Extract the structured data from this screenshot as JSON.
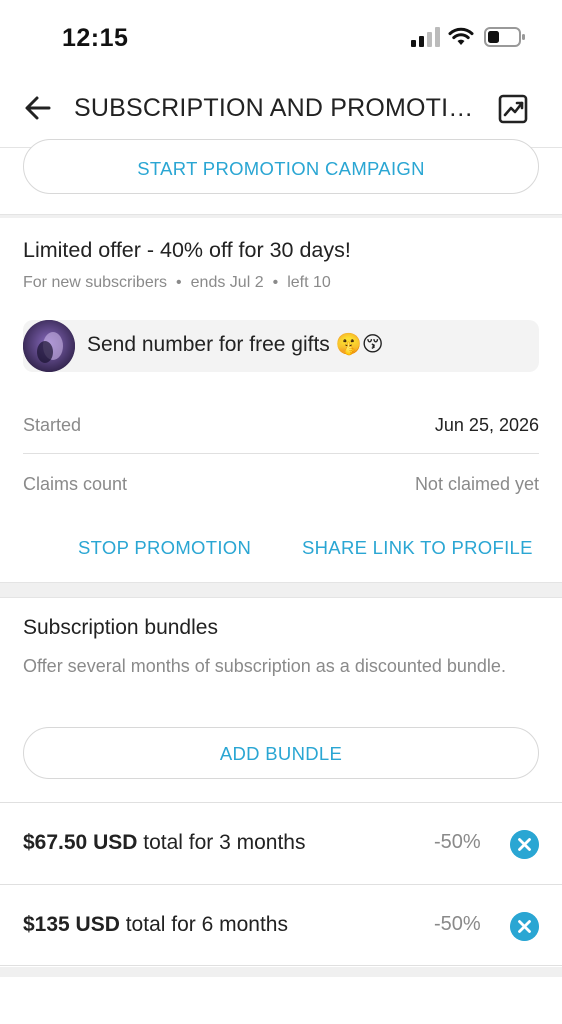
{
  "status_bar": {
    "time": "12:15"
  },
  "header": {
    "title": "SUBSCRIPTION AND PROMOTIONS"
  },
  "promotion": {
    "start_campaign_label": "START PROMOTION CAMPAIGN",
    "offer_title": "Limited offer - 40% off for 30 days!",
    "meta": {
      "audience": "For new subscribers",
      "ends": "ends Jul 2",
      "left": "left 10"
    },
    "message": "Send number for free gifts 🤫😚",
    "started_label": "Started",
    "started_value": "Jun 25, 2026",
    "claims_label": "Claims count",
    "claims_value": "Not claimed yet",
    "stop_label": "STOP PROMOTION",
    "share_label": "SHARE LINK TO PROFILE"
  },
  "bundles": {
    "title": "Subscription bundles",
    "description": "Offer several months of subscription as a discounted bundle.",
    "add_label": "ADD BUNDLE",
    "items": [
      {
        "price": "$67.50 USD",
        "duration": " total for 3 months",
        "discount": "-50%"
      },
      {
        "price": "$135 USD",
        "duration": " total for 6 months",
        "discount": "-50%"
      }
    ]
  },
  "colors": {
    "accent": "#2aa6d3",
    "muted_text": "#8a8a8a",
    "divider": "#e0e0e0",
    "section_gap": "#f0f0f0"
  },
  "icons": [
    "back-arrow-icon",
    "statistics-icon",
    "cell-signal-icon",
    "wifi-icon",
    "battery-icon",
    "remove-icon"
  ]
}
